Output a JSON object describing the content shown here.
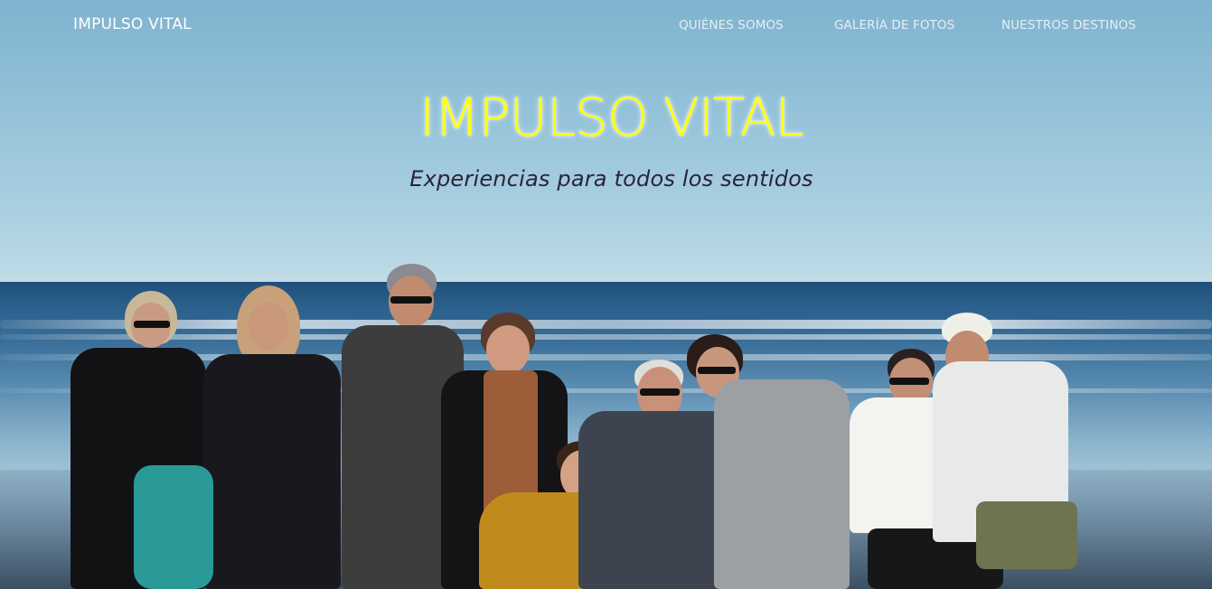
{
  "navbar": {
    "brand": "IMPULSO VITAL",
    "links": [
      {
        "label": "QUIÉNES SOMOS"
      },
      {
        "label": "GALERÍA DE FOTOS"
      },
      {
        "label": "NUESTROS DESTINOS"
      }
    ]
  },
  "hero": {
    "title": "IMPULSO VITAL",
    "subtitle": "Experiencias para todos los sentidos",
    "title_color": "#ffff00",
    "subtitle_color": "#2a2438"
  },
  "background": {
    "sky_color": "#a9cfe0",
    "sea_color": "#2b5f8c",
    "sand_color": "#6f8ea5"
  }
}
